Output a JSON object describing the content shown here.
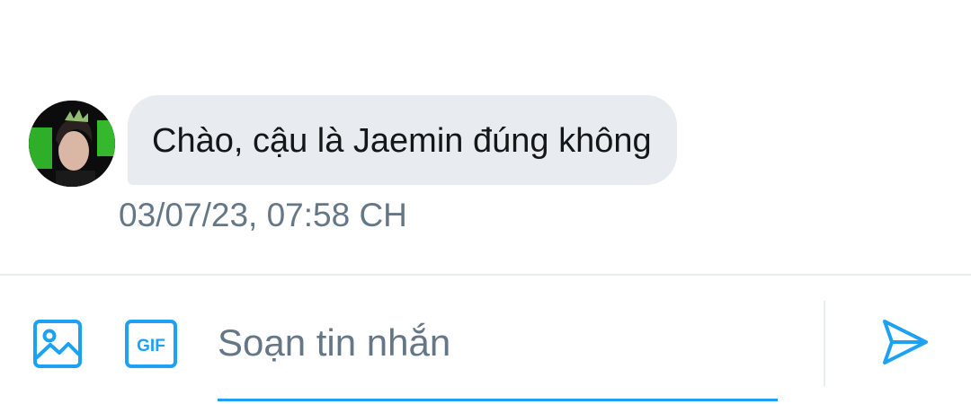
{
  "conversation": {
    "messages": [
      {
        "text": "Chào, cậu là Jaemin đúng không",
        "timestamp": "03/07/23, 07:58 CH",
        "avatar": "user-photo"
      }
    ]
  },
  "composer": {
    "placeholder": "Soạn tin nhắn",
    "value": "",
    "media_icon": "image-icon",
    "gif_icon": "gif-icon",
    "gif_label": "GIF",
    "send_icon": "send-icon"
  },
  "colors": {
    "accent": "#1da1f2",
    "bubble": "#e8ebef",
    "text": "#14171a",
    "secondary_text": "#657786",
    "divider": "#e6ecf0"
  }
}
